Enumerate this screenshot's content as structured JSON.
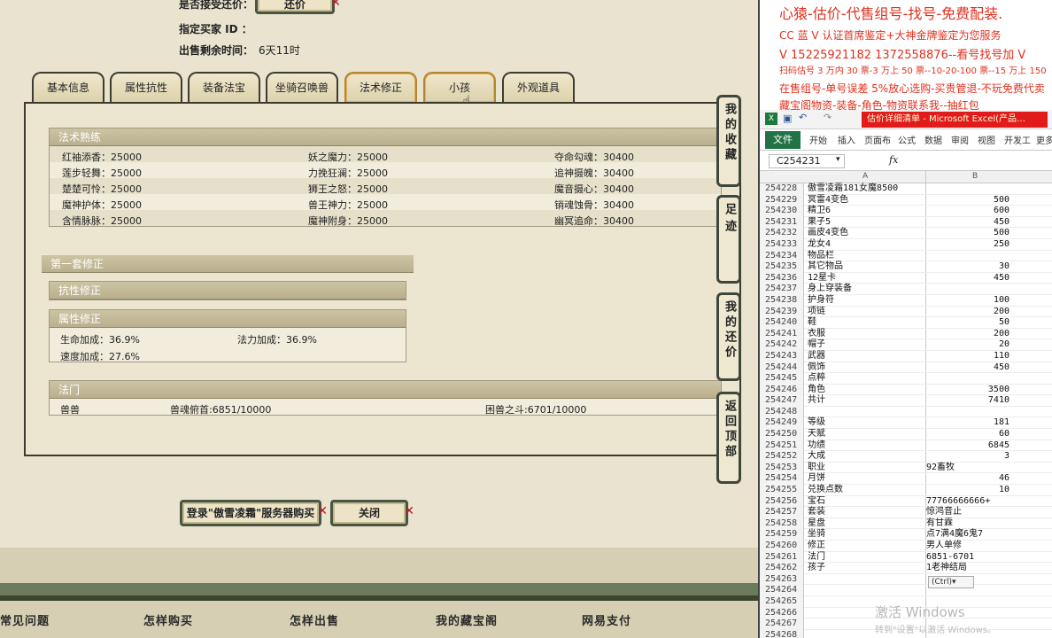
{
  "game": {
    "info": {
      "counter_offer_label": "是否接受还价：",
      "counter_offer_button": "还价",
      "buyer_label": "指定买家 ID ：",
      "time_label": "出售剩余时间：",
      "time_value": "6天11时"
    },
    "tabs": [
      "基本信息",
      "属性抗性",
      "装备法宝",
      "坐骑召唤兽",
      "法术修正",
      "小孩",
      "外观道具"
    ],
    "skills": {
      "title": "法术熟练",
      "rows": [
        [
          "红袖添香：25000",
          "妖之魔力：25000",
          "夺命勾魂：30400"
        ],
        [
          "莲步轻舞：25000",
          "力挽狂澜：25000",
          "追神摄魄：30400"
        ],
        [
          "楚楚可怜：25000",
          "狮王之怒：25000",
          "魔音摄心：30400"
        ],
        [
          "魔神护体：25000",
          "兽王神力：25000",
          "销魂蚀骨：30400"
        ],
        [
          "含情脉脉：25000",
          "魔神附身：25000",
          "幽冥追命：30400"
        ]
      ]
    },
    "correction": {
      "title": "第一套修正",
      "resist_title": "抗性修正",
      "attr_title": "属性修正",
      "attrs": [
        "生命加成：36.9%",
        "法力加成：36.9%",
        "速度加成：27.6%"
      ]
    },
    "magic": {
      "title": "法门",
      "cells": [
        "兽兽",
        "兽魂俯首:6851/10000",
        "困兽之斗:6701/10000"
      ]
    },
    "side_tabs": [
      "我的收藏",
      "足迹",
      "我的还价",
      "返回顶部"
    ],
    "login_button": "登录\"傲雪凌霜\"服务器购买",
    "close_button": "关闭",
    "footer_links": [
      "常见问题",
      "怎样购买",
      "怎样出售",
      "我的藏宝阁",
      "网易支付"
    ]
  },
  "right_text": [
    "心猿-估价-代售组号-找号-免费配装.",
    "CC 蓝 V 认证首席鉴定+大神金牌鉴定为您服务",
    "V 15225921182    1372558876--看号找号加 V",
    "扫码估号 3 万内 30 票-3 万上 50 票--10-20-100 票--15 万上 150",
    "在售组号-单号误差 5%放心选购-买贵管退-不玩免费代卖",
    "藏宝阁物资-装备-角色-物资联系我--抽红包"
  ],
  "excel": {
    "title": "估价详细清单 - Microsoft Excel(产品…",
    "file_tab": "文件",
    "ribbon_tabs": [
      "开始",
      "插入",
      "页面布",
      "公式",
      "数据",
      "审阅",
      "视图",
      "开发工",
      "更多"
    ],
    "name_box": "C254231",
    "fx": "fx",
    "col_a": "A",
    "col_b": "B",
    "rows": [
      {
        "n": "254228",
        "a": "傲雪凌霜181女魔8500",
        "b": ""
      },
      {
        "n": "254229",
        "a": "冥雷4变色",
        "b": "500"
      },
      {
        "n": "254230",
        "a": "精卫6",
        "b": "600"
      },
      {
        "n": "254231",
        "a": "果子5",
        "b": "450"
      },
      {
        "n": "254232",
        "a": "画皮4变色",
        "b": "500"
      },
      {
        "n": "254233",
        "a": "龙女4",
        "b": "250"
      },
      {
        "n": "254234",
        "a": "物品栏",
        "b": ""
      },
      {
        "n": "254235",
        "a": "其它物品",
        "b": "30"
      },
      {
        "n": "254236",
        "a": "12星卡",
        "b": "450"
      },
      {
        "n": "254237",
        "a": "身上穿装备",
        "b": ""
      },
      {
        "n": "254238",
        "a": "护身符",
        "b": "100"
      },
      {
        "n": "254239",
        "a": "项链",
        "b": "200"
      },
      {
        "n": "254240",
        "a": "鞋",
        "b": "50"
      },
      {
        "n": "254241",
        "a": "衣服",
        "b": "200"
      },
      {
        "n": "254242",
        "a": "帽子",
        "b": "20"
      },
      {
        "n": "254243",
        "a": "武器",
        "b": "110"
      },
      {
        "n": "254244",
        "a": "佩饰",
        "b": "450"
      },
      {
        "n": "254245",
        "a": "点粹",
        "b": ""
      },
      {
        "n": "254246",
        "a": "角色",
        "b": "3500"
      },
      {
        "n": "254247",
        "a": "共计",
        "b": "7410"
      },
      {
        "n": "254248",
        "a": "",
        "b": ""
      },
      {
        "n": "254249",
        "a": "等级",
        "b": "181"
      },
      {
        "n": "254250",
        "a": "天赋",
        "b": "60"
      },
      {
        "n": "254251",
        "a": "功绩",
        "b": "6845"
      },
      {
        "n": "254252",
        "a": "大成",
        "b": "3"
      },
      {
        "n": "254253",
        "a": "职业",
        "b": "92畜牧",
        "t": true
      },
      {
        "n": "254254",
        "a": "月饼",
        "b": "46"
      },
      {
        "n": "254255",
        "a": "兑换点数",
        "b": "10"
      },
      {
        "n": "254256",
        "a": "宝石",
        "b": "77766666666+",
        "t": true
      },
      {
        "n": "254257",
        "a": "套装",
        "b": "惊鸿音止",
        "t": true
      },
      {
        "n": "254258",
        "a": "星盘",
        "b": "有甘霖",
        "t": true
      },
      {
        "n": "254259",
        "a": "坐骑",
        "b": "点7满4魔6鬼7",
        "t": true
      },
      {
        "n": "254260",
        "a": "修正",
        "b": "男人单修",
        "t": true
      },
      {
        "n": "254261",
        "a": "法门",
        "b": "6851-6701",
        "t": true
      },
      {
        "n": "254262",
        "a": "孩子",
        "b": "1老神结局",
        "t": true
      },
      {
        "n": "254263",
        "a": "",
        "b": ""
      },
      {
        "n": "254264",
        "a": "",
        "b": ""
      },
      {
        "n": "254265",
        "a": "",
        "b": ""
      },
      {
        "n": "254266",
        "a": "",
        "b": ""
      },
      {
        "n": "254267",
        "a": "",
        "b": ""
      },
      {
        "n": "254268",
        "a": "",
        "b": ""
      }
    ],
    "ctrl_tag": "(Ctrl)▾",
    "watermark": "激活 Windows",
    "watermark_sub": "转到\"设置\"以激活 Windows。"
  }
}
